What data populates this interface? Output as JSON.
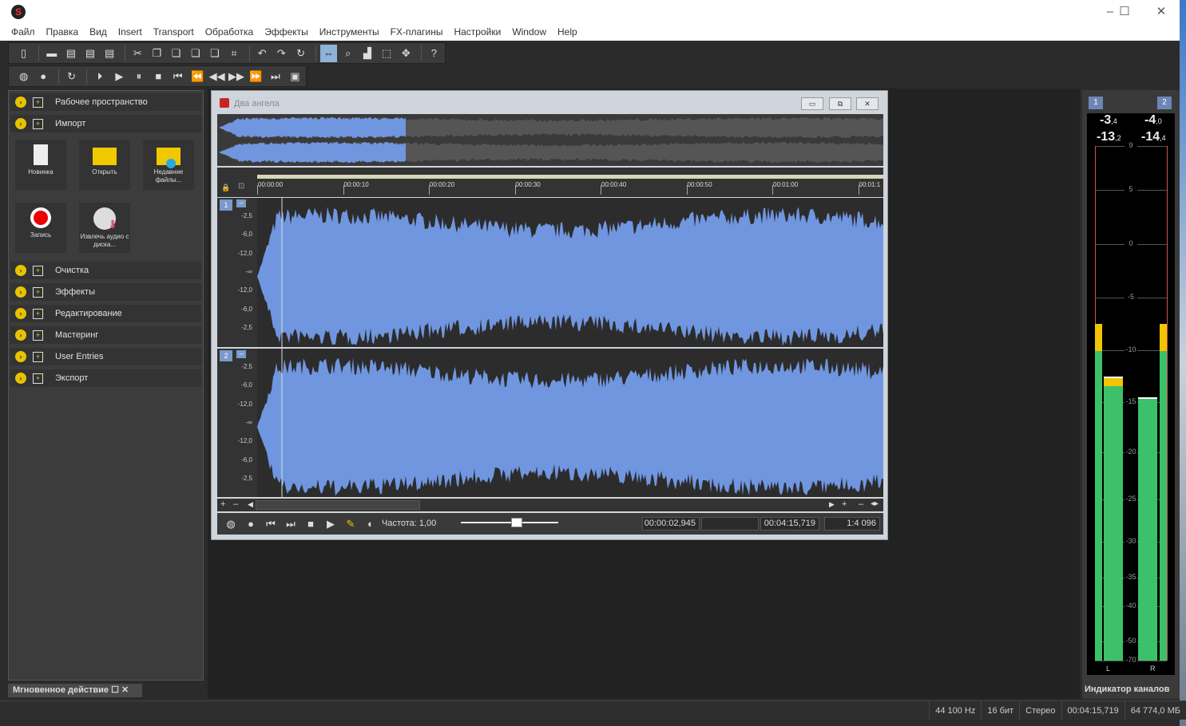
{
  "app": {
    "window_controls": [
      "minimize",
      "maximize",
      "close"
    ]
  },
  "menu": [
    "Файл",
    "Правка",
    "Вид",
    "Insert",
    "Transport",
    "Обработка",
    "Эффекты",
    "Инструменты",
    "FX-плагины",
    "Настройки",
    "Window",
    "Help"
  ],
  "left_panel": {
    "sections": [
      {
        "label": "Рабочее пространство",
        "icon": "workspace-icon"
      },
      {
        "label": "Импорт",
        "icon": "import-icon",
        "expanded": true
      }
    ],
    "tiles": [
      {
        "label": "Новинка",
        "icon": "new-file-icon"
      },
      {
        "label": "Открыть",
        "icon": "open-folder-icon"
      },
      {
        "label": "Недавние файлы...",
        "icon": "recent-files-icon"
      },
      {
        "label": "Запись",
        "icon": "record-icon"
      },
      {
        "label": "Извлечь аудио с диска...",
        "icon": "extract-cd-icon"
      }
    ],
    "sections_after": [
      {
        "label": "Очистка"
      },
      {
        "label": "Эффекты"
      },
      {
        "label": "Редактирование"
      },
      {
        "label": "Мастеринг"
      },
      {
        "label": "User Entries"
      },
      {
        "label": "Экспорт"
      }
    ]
  },
  "bottom_tab": {
    "label": "Мгновенное действие"
  },
  "document": {
    "title": "Два ангела",
    "ruler": [
      "00:00:00",
      "00:00:10",
      "00:00:20",
      "00:00:30",
      "00:00:40",
      "00:00:50",
      "00:01:00",
      "00:01:1"
    ],
    "tracks": [
      {
        "num": "1"
      },
      {
        "num": "2"
      }
    ],
    "db_scale": [
      "-2,5",
      "-6,0",
      "-12,0",
      "-∞",
      "-12,0",
      "-6,0",
      "-2,5"
    ],
    "transport": {
      "rate_label": "Частота: 1,00",
      "rate": 1.0,
      "cursor_time": "00:00:02,945",
      "selection": "",
      "length": "00:04:15,719",
      "zoom": "1:4 096"
    }
  },
  "meter": {
    "title": "Индикатор каналов",
    "channels": [
      {
        "num": "1",
        "peak": "-3",
        "peak_dec": ",4",
        "rms": "-13",
        "rms_dec": ",2",
        "label": "L",
        "peak_db": -7.5,
        "level_db": -12.5
      },
      {
        "num": "2",
        "peak": "-4",
        "peak_dec": ",0",
        "rms": "-14",
        "rms_dec": ",4",
        "label": "R",
        "peak_db": -7.5,
        "level_db": -14.5
      }
    ],
    "scale": [
      "9",
      "5",
      "0",
      "-5",
      "-10",
      "-15",
      "-20",
      "-25",
      "-30",
      "-35",
      "-40",
      "-50",
      "-70"
    ],
    "colors": {
      "level": "#3cc16a",
      "peak": "#f2c500"
    }
  },
  "status": [
    "44 100 Hz",
    "16 бит",
    "Стерео",
    "00:04:15,719",
    "64 774,0 МБ"
  ],
  "colors": {
    "waveform": "#7096e0",
    "panel": "#3c3c3c",
    "accent": "#e8c300"
  }
}
